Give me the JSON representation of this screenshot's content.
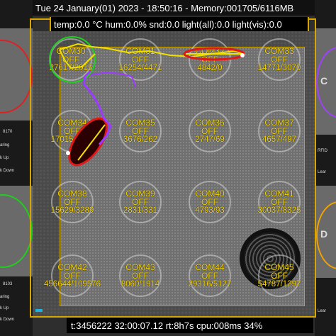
{
  "header": {
    "datetime_memory": "Tue 24 January(01) 2023 - 18:50:16 - Memory:001705/6116MB",
    "sensors": "temp:0.0 °C hum:0.0% snd:0.0 light(all):0.0 light(vis):0.0"
  },
  "footer": {
    "status": "t:3456222 32:00:07.12 rt:8h7s cpu:008ms 34%"
  },
  "left_panel": {
    "labels": [
      "8170",
      "aring",
      "k Up",
      "k Down",
      "8103",
      "aring",
      "k Up",
      "k Down"
    ]
  },
  "right_panel": {
    "letters": [
      "C",
      "D"
    ],
    "labels": [
      "RFID",
      "Lear",
      "Lear"
    ]
  },
  "coms": [
    {
      "name": "COM30",
      "state": "OFF",
      "value": "27617/2015"
    },
    {
      "name": "COM31",
      "state": "OFF",
      "value": "16254/4471"
    },
    {
      "name": "COM32",
      "state": "OFF",
      "value": "4842/0"
    },
    {
      "name": "COM33",
      "state": "OFF",
      "value": "14771/3070"
    },
    {
      "name": "COM34",
      "state": "OFF",
      "value": "17015/4913"
    },
    {
      "name": "COM35",
      "state": "OFF",
      "value": "3676/262"
    },
    {
      "name": "COM36",
      "state": "OFF",
      "value": "2747/69"
    },
    {
      "name": "COM37",
      "state": "OFF",
      "value": "4657/497"
    },
    {
      "name": "COM38",
      "state": "OFF",
      "value": "15629/3289"
    },
    {
      "name": "COM39",
      "state": "OFF",
      "value": "2831/331"
    },
    {
      "name": "COM40",
      "state": "OFF",
      "value": "4793/93"
    },
    {
      "name": "COM41",
      "state": "OFF",
      "value": "30037/8325"
    },
    {
      "name": "COM42",
      "state": "OFF",
      "value": "456644/109576"
    },
    {
      "name": "COM43",
      "state": "OFF",
      "value": "8060/1914"
    },
    {
      "name": "COM44",
      "state": "OFF",
      "value": "29316/5127"
    },
    {
      "name": "COM45",
      "state": "OFF",
      "value": "54787/1297"
    }
  ],
  "colors": {
    "label_yellow": "#f5d300",
    "arena_border": "#d8a400",
    "track_purple": "#9a3cff",
    "track_yellow": "#f0e000",
    "animal_red": "#e01818",
    "ring_green": "#1fcf1f",
    "ring_purple": "#a040ff",
    "ring_red": "#e02020"
  }
}
